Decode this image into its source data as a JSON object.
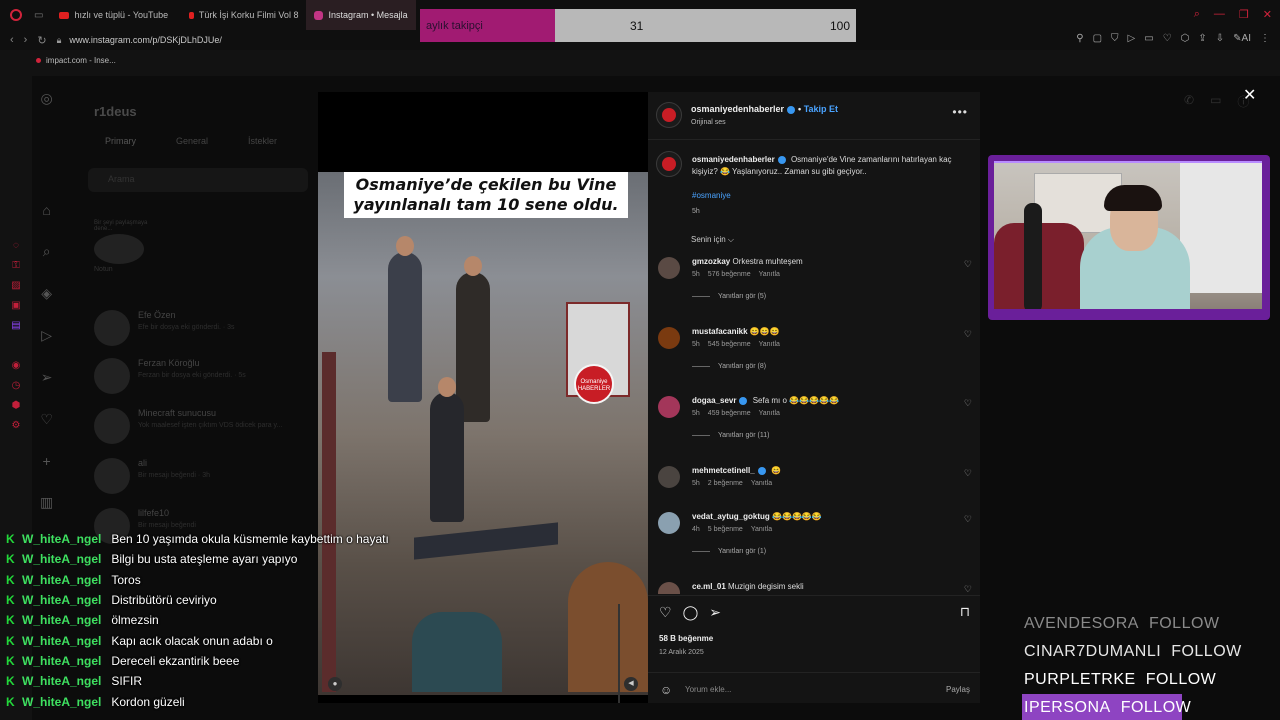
{
  "browser": {
    "tabs": [
      {
        "label": "hızlı ve tüplü - YouTube",
        "icon": "youtube-icon"
      },
      {
        "label": "Türk İşi Korku Filmi Vol 8",
        "icon": "youtube-icon"
      },
      {
        "label": "Instagram • Mesajla",
        "icon": "instagram-icon"
      }
    ],
    "url": "www.instagram.com/p/DSKjDLhDJUe/",
    "bookmark": "impact.com - Inse..."
  },
  "follow_goal": {
    "label": "aylık takipçi",
    "current": "31",
    "max": "100",
    "progress": 0.31
  },
  "instagram_bg": {
    "username": "r1deus",
    "tabs": [
      "Primary",
      "General",
      "İstekler"
    ],
    "search_placeholder": "Arama",
    "note_label": "Notun",
    "note_text": "Bir şeyi paylaşmaya dene...",
    "dms": [
      {
        "name": "Efe Özen",
        "preview": "Efe bir dosya eki gönderdi. · 3s"
      },
      {
        "name": "Ferzan Köroğlu",
        "preview": "Ferzan bir dosya eki gönderdi. · 5s"
      },
      {
        "name": "Minecraft sunucusu",
        "preview": "Yok maalesef işten çıktım VDS ödicek para y..."
      },
      {
        "name": "ali",
        "preview": "Bir mesajı beğendi · 3h"
      },
      {
        "name": "lilfefe10",
        "preview": "Bir mesajı beğendi"
      }
    ]
  },
  "post": {
    "caption_overlay": "Osmaniye’de çekilen bu Vine yayınlanalı tam 10 sene oldu.",
    "badge_text": "Osmaniye HABERLER",
    "author": "osmaniyedenhaberler",
    "follow_label": "Takip Et",
    "audio": "Orijinal ses",
    "caption": "Osmaniye'de Vine zamanlarını hatırlayan kaç kişiyiz? 😂 Yaşlanıyoruz.. Zaman su gibi geçiyor..",
    "hashtag": "#osmaniye",
    "time": "5h",
    "for_you": "Senin için ⌵",
    "comments": [
      {
        "user": "gmzozkay",
        "text": "Orkestra muhteşem",
        "time": "5h",
        "likes": "576 beğenme",
        "reply": "Yanıtla",
        "replies": "Yanıtları gör (5)"
      },
      {
        "user": "mustafacanikk",
        "text": "😄😄😄",
        "time": "5h",
        "likes": "545 beğenme",
        "reply": "Yanıtla",
        "replies": "Yanıtları gör (8)"
      },
      {
        "user": "dogaa_sevr",
        "text": "Sefa mı o 😂😂😂😂😂",
        "time": "5h",
        "likes": "459 beğenme",
        "reply": "Yanıtla",
        "replies": "Yanıtları gör (11)"
      },
      {
        "user": "mehmetcetinell_",
        "text": "😄",
        "time": "5h",
        "likes": "2 beğenme",
        "reply": "Yanıtla",
        "replies": ""
      },
      {
        "user": "vedat_aytug_goktug",
        "text": "😂😂😂😂😂",
        "time": "4h",
        "likes": "5 beğenme",
        "reply": "Yanıtla",
        "replies": "Yanıtları gör (1)"
      },
      {
        "user": "ce.ml_01",
        "text": "Muzigin degisim sekli",
        "time": "",
        "likes": "",
        "reply": "",
        "replies": ""
      }
    ],
    "likes": "58 B beğenme",
    "date": "12 Aralık 2025",
    "comment_placeholder": "Yorum ekle...",
    "share_label": "Paylaş"
  },
  "chat": [
    {
      "user": "W_hiteA_ngel",
      "msg": "Ben 10 yaşımda okula küsmemle kaybettim o hayatı"
    },
    {
      "user": "W_hiteA_ngel",
      "msg": "Bilgi bu usta ateşleme ayarı yapıyo"
    },
    {
      "user": "W_hiteA_ngel",
      "msg": "Toros"
    },
    {
      "user": "W_hiteA_ngel",
      "msg": "Distribütörü ceviriyo"
    },
    {
      "user": "W_hiteA_ngel",
      "msg": "ölmezsin"
    },
    {
      "user": "W_hiteA_ngel",
      "msg": "Kapı acık olacak onun adabı o"
    },
    {
      "user": "W_hiteA_ngel",
      "msg": "Dereceli ekzantirik beee"
    },
    {
      "user": "W_hiteA_ngel",
      "msg": "SIFIR"
    },
    {
      "user": "W_hiteA_ngel",
      "msg": "Kordon güzeli"
    }
  ],
  "follow_ticker": [
    {
      "name": "AVENDESORA",
      "action": "FOLLOW",
      "style": "dim"
    },
    {
      "name": "CINAR7DUMANLI",
      "action": "FOLLOW",
      "style": "mid"
    },
    {
      "name": "PURPLETRKE",
      "action": "FOLLOW",
      "style": "white"
    },
    {
      "name": "IPERSONA",
      "action": "FOLLOW",
      "style": "hi"
    }
  ],
  "colors": {
    "accent": "#d0233b",
    "follow_fill": "#a11b72",
    "cam_frame": "#6a1f9a",
    "chat_user": "#3ee060",
    "link": "#4aa3ff"
  }
}
